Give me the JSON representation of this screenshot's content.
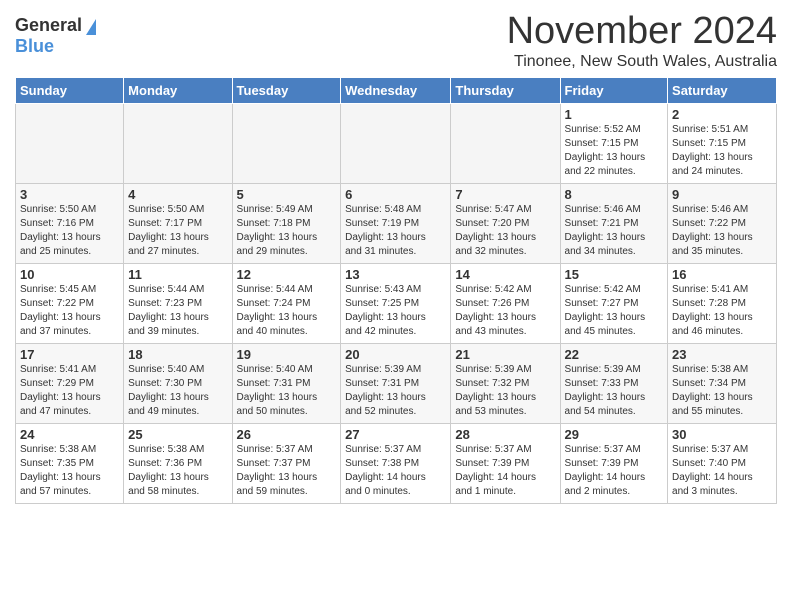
{
  "logo": {
    "general": "General",
    "blue": "Blue"
  },
  "title": "November 2024",
  "location": "Tinonee, New South Wales, Australia",
  "weekdays": [
    "Sunday",
    "Monday",
    "Tuesday",
    "Wednesday",
    "Thursday",
    "Friday",
    "Saturday"
  ],
  "rows": [
    [
      {
        "day": "",
        "empty": true
      },
      {
        "day": "",
        "empty": true
      },
      {
        "day": "",
        "empty": true
      },
      {
        "day": "",
        "empty": true
      },
      {
        "day": "",
        "empty": true
      },
      {
        "day": "1",
        "info": "Sunrise: 5:52 AM\nSunset: 7:15 PM\nDaylight: 13 hours\nand 22 minutes."
      },
      {
        "day": "2",
        "info": "Sunrise: 5:51 AM\nSunset: 7:15 PM\nDaylight: 13 hours\nand 24 minutes."
      }
    ],
    [
      {
        "day": "3",
        "info": "Sunrise: 5:50 AM\nSunset: 7:16 PM\nDaylight: 13 hours\nand 25 minutes."
      },
      {
        "day": "4",
        "info": "Sunrise: 5:50 AM\nSunset: 7:17 PM\nDaylight: 13 hours\nand 27 minutes."
      },
      {
        "day": "5",
        "info": "Sunrise: 5:49 AM\nSunset: 7:18 PM\nDaylight: 13 hours\nand 29 minutes."
      },
      {
        "day": "6",
        "info": "Sunrise: 5:48 AM\nSunset: 7:19 PM\nDaylight: 13 hours\nand 31 minutes."
      },
      {
        "day": "7",
        "info": "Sunrise: 5:47 AM\nSunset: 7:20 PM\nDaylight: 13 hours\nand 32 minutes."
      },
      {
        "day": "8",
        "info": "Sunrise: 5:46 AM\nSunset: 7:21 PM\nDaylight: 13 hours\nand 34 minutes."
      },
      {
        "day": "9",
        "info": "Sunrise: 5:46 AM\nSunset: 7:22 PM\nDaylight: 13 hours\nand 35 minutes."
      }
    ],
    [
      {
        "day": "10",
        "info": "Sunrise: 5:45 AM\nSunset: 7:22 PM\nDaylight: 13 hours\nand 37 minutes."
      },
      {
        "day": "11",
        "info": "Sunrise: 5:44 AM\nSunset: 7:23 PM\nDaylight: 13 hours\nand 39 minutes."
      },
      {
        "day": "12",
        "info": "Sunrise: 5:44 AM\nSunset: 7:24 PM\nDaylight: 13 hours\nand 40 minutes."
      },
      {
        "day": "13",
        "info": "Sunrise: 5:43 AM\nSunset: 7:25 PM\nDaylight: 13 hours\nand 42 minutes."
      },
      {
        "day": "14",
        "info": "Sunrise: 5:42 AM\nSunset: 7:26 PM\nDaylight: 13 hours\nand 43 minutes."
      },
      {
        "day": "15",
        "info": "Sunrise: 5:42 AM\nSunset: 7:27 PM\nDaylight: 13 hours\nand 45 minutes."
      },
      {
        "day": "16",
        "info": "Sunrise: 5:41 AM\nSunset: 7:28 PM\nDaylight: 13 hours\nand 46 minutes."
      }
    ],
    [
      {
        "day": "17",
        "info": "Sunrise: 5:41 AM\nSunset: 7:29 PM\nDaylight: 13 hours\nand 47 minutes."
      },
      {
        "day": "18",
        "info": "Sunrise: 5:40 AM\nSunset: 7:30 PM\nDaylight: 13 hours\nand 49 minutes."
      },
      {
        "day": "19",
        "info": "Sunrise: 5:40 AM\nSunset: 7:31 PM\nDaylight: 13 hours\nand 50 minutes."
      },
      {
        "day": "20",
        "info": "Sunrise: 5:39 AM\nSunset: 7:31 PM\nDaylight: 13 hours\nand 52 minutes."
      },
      {
        "day": "21",
        "info": "Sunrise: 5:39 AM\nSunset: 7:32 PM\nDaylight: 13 hours\nand 53 minutes."
      },
      {
        "day": "22",
        "info": "Sunrise: 5:39 AM\nSunset: 7:33 PM\nDaylight: 13 hours\nand 54 minutes."
      },
      {
        "day": "23",
        "info": "Sunrise: 5:38 AM\nSunset: 7:34 PM\nDaylight: 13 hours\nand 55 minutes."
      }
    ],
    [
      {
        "day": "24",
        "info": "Sunrise: 5:38 AM\nSunset: 7:35 PM\nDaylight: 13 hours\nand 57 minutes."
      },
      {
        "day": "25",
        "info": "Sunrise: 5:38 AM\nSunset: 7:36 PM\nDaylight: 13 hours\nand 58 minutes."
      },
      {
        "day": "26",
        "info": "Sunrise: 5:37 AM\nSunset: 7:37 PM\nDaylight: 13 hours\nand 59 minutes."
      },
      {
        "day": "27",
        "info": "Sunrise: 5:37 AM\nSunset: 7:38 PM\nDaylight: 14 hours\nand 0 minutes."
      },
      {
        "day": "28",
        "info": "Sunrise: 5:37 AM\nSunset: 7:39 PM\nDaylight: 14 hours\nand 1 minute."
      },
      {
        "day": "29",
        "info": "Sunrise: 5:37 AM\nSunset: 7:39 PM\nDaylight: 14 hours\nand 2 minutes."
      },
      {
        "day": "30",
        "info": "Sunrise: 5:37 AM\nSunset: 7:40 PM\nDaylight: 14 hours\nand 3 minutes."
      }
    ]
  ]
}
